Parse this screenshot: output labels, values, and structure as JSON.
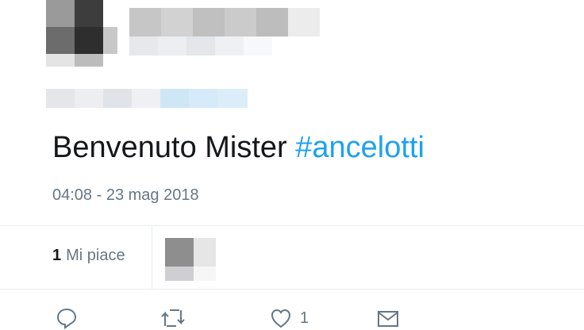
{
  "tweet": {
    "text": "Benvenuto Mister ",
    "hashtag": "#ancelotti",
    "timestamp": "04:08 - 23 mag 2018"
  },
  "stats": {
    "likes_count": "1",
    "likes_label": "Mi piace"
  },
  "actions": {
    "reply_icon": "reply-icon",
    "retweet_icon": "retweet-icon",
    "like_icon": "heart-icon",
    "like_count": "1",
    "dm_icon": "envelope-icon"
  },
  "colors": {
    "hashtag": "#1da1f2",
    "muted": "#657786",
    "divider": "#e6ecf0"
  }
}
